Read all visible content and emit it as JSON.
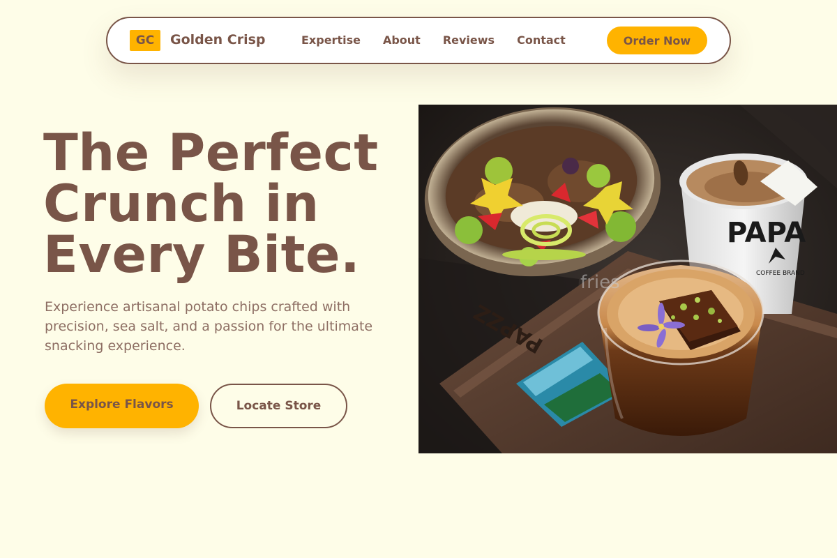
{
  "nav": {
    "logo_initials": "GC",
    "brand_name": "Golden Crisp",
    "links": [
      "Expertise",
      "About",
      "Reviews",
      "Contact"
    ],
    "cta": "Order Now"
  },
  "hero": {
    "headline_line1": "The Perfect",
    "headline_line2": "Crunch in",
    "headline_line3": "Every Bite.",
    "subhead": "Experience artisanal potato chips crafted with precision, sea salt, and a passion for the ultimate snacking experience.",
    "primary_button": "Explore Flavors",
    "secondary_button": "Locate Store",
    "image_alt": "fries"
  },
  "photo": {
    "cup_text": "PAPA",
    "cup_subtext": "COFFEE BRAND",
    "tray_text": "PAPZZ"
  },
  "colors": {
    "background": "#FEFDE8",
    "brown": "#795548",
    "accent": "#FFB300"
  }
}
